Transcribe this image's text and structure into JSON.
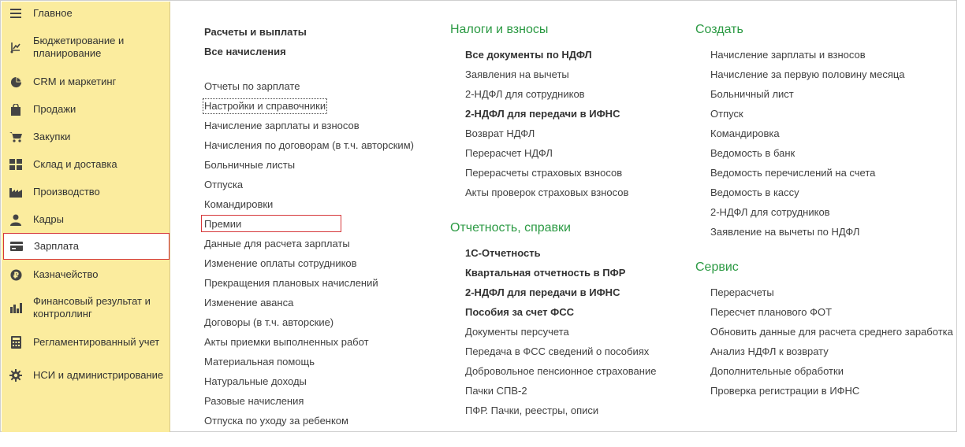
{
  "sidebar": {
    "items": [
      {
        "label": "Главное",
        "icon": "menu-icon"
      },
      {
        "label": "Бюджетирование и планирование",
        "icon": "budget-icon"
      },
      {
        "label": "CRM и маркетинг",
        "icon": "pie-chart-icon"
      },
      {
        "label": "Продажи",
        "icon": "shopping-bag-icon"
      },
      {
        "label": "Закупки",
        "icon": "cart-icon"
      },
      {
        "label": "Склад и доставка",
        "icon": "warehouse-grid-icon"
      },
      {
        "label": "Производство",
        "icon": "factory-icon"
      },
      {
        "label": "Кадры",
        "icon": "person-icon"
      },
      {
        "label": "Зарплата",
        "icon": "wallet-icon",
        "active": true
      },
      {
        "label": "Казначейство",
        "icon": "ruble-coin-icon"
      },
      {
        "label": "Финансовый результат и контроллинг",
        "icon": "bar-chart-icon"
      },
      {
        "label": "Регламентированный учет",
        "icon": "calculator-icon"
      },
      {
        "label": "НСИ и администрирование",
        "icon": "gear-icon"
      }
    ]
  },
  "col1": {
    "header_bold": [
      "Расчеты и выплаты",
      "Все начисления"
    ],
    "links": [
      "Отчеты по зарплате",
      "Настройки и справочники",
      "Начисление зарплаты и взносов",
      "Начисления по договорам (в т.ч. авторским)",
      "Больничные листы",
      "Отпуска",
      "Командировки",
      "Премии",
      "Данные для расчета зарплаты",
      "Изменение оплаты сотрудников",
      "Прекращения плановых начислений",
      "Изменение аванса",
      "Договоры (в т.ч. авторские)",
      "Акты приемки выполненных работ",
      "Материальная помощь",
      "Натуральные доходы",
      "Разовые начисления",
      "Отпуска по уходу за ребенком"
    ]
  },
  "col2": {
    "taxes_title": "Налоги и взносы",
    "taxes_links": [
      {
        "label": "Все документы по НДФЛ",
        "bold": true
      },
      {
        "label": "Заявления на вычеты",
        "bold": false
      },
      {
        "label": "2-НДФЛ для сотрудников",
        "bold": false
      },
      {
        "label": "2-НДФЛ для передачи в ИФНС",
        "bold": true
      },
      {
        "label": "Возврат НДФЛ",
        "bold": false
      },
      {
        "label": "Перерасчет НДФЛ",
        "bold": false
      },
      {
        "label": "Перерасчеты страховых взносов",
        "bold": false
      },
      {
        "label": "Акты проверок страховых взносов",
        "bold": false
      }
    ],
    "reports_title": "Отчетность, справки",
    "reports_links": [
      {
        "label": "1С-Отчетность",
        "bold": true
      },
      {
        "label": "Квартальная отчетность в ПФР",
        "bold": true
      },
      {
        "label": "2-НДФЛ для передачи в ИФНС",
        "bold": true
      },
      {
        "label": "Пособия за счет ФСС",
        "bold": true
      },
      {
        "label": "Документы персучета",
        "bold": false
      },
      {
        "label": "Передача в ФСС сведений о пособиях",
        "bold": false
      },
      {
        "label": "Добровольное пенсионное страхование",
        "bold": false
      },
      {
        "label": "Пачки СПВ-2",
        "bold": false
      },
      {
        "label": "ПФР. Пачки, реестры, описи",
        "bold": false
      }
    ]
  },
  "col3": {
    "create_title": "Создать",
    "create_links": [
      "Начисление зарплаты и взносов",
      "Начисление за первую половину месяца",
      "Больничный лист",
      "Отпуск",
      "Командировка",
      "Ведомость в банк",
      "Ведомость перечислений на счета",
      "Ведомость в кассу",
      "2-НДФЛ для сотрудников",
      "Заявление на вычеты по НДФЛ"
    ],
    "service_title": "Сервис",
    "service_links": [
      "Перерасчеты",
      "Пересчет планового ФОТ",
      "Обновить данные для расчета среднего заработка",
      "Анализ НДФЛ к возврату",
      "Дополнительные обработки",
      "Проверка регистрации в ИФНС"
    ]
  },
  "colors": {
    "sidebar_bg": "#fbec9e",
    "section_title": "#2b9a43",
    "highlight_border": "#d6383a"
  }
}
